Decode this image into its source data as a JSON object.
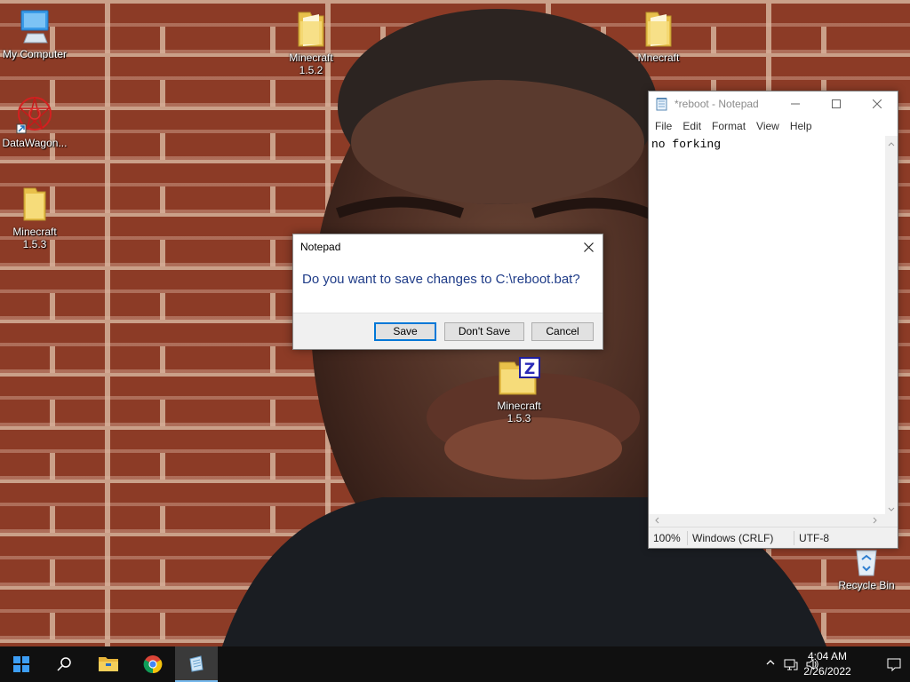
{
  "desktop": {
    "icons": [
      {
        "label": "My Computer"
      },
      {
        "label": "DataWagon..."
      },
      {
        "label": "Minecraft 1.5.3"
      },
      {
        "label": "Minecraft 1.5.2"
      },
      {
        "label": "Minecraft 1.5.3"
      },
      {
        "label": "Mnecraft"
      },
      {
        "label": "Recycle Bin"
      }
    ]
  },
  "notepad": {
    "title": "*reboot - Notepad",
    "menu": [
      "File",
      "Edit",
      "Format",
      "View",
      "Help"
    ],
    "content": "no forking",
    "status": {
      "zoom": "100%",
      "line_ending": "Windows (CRLF)",
      "encoding": "UTF-8"
    }
  },
  "dialog": {
    "title": "Notepad",
    "message": "Do you want to save changes to C:\\reboot.bat?",
    "buttons": {
      "save": "Save",
      "dont_save": "Don't Save",
      "cancel": "Cancel"
    }
  },
  "taskbar": {
    "clock": {
      "time": "4:04 AM",
      "date": "2/26/2022"
    }
  },
  "colors": {
    "taskbar_bg": "#101010",
    "accent": "#0078d7",
    "dialog_message": "#1f3c88"
  }
}
